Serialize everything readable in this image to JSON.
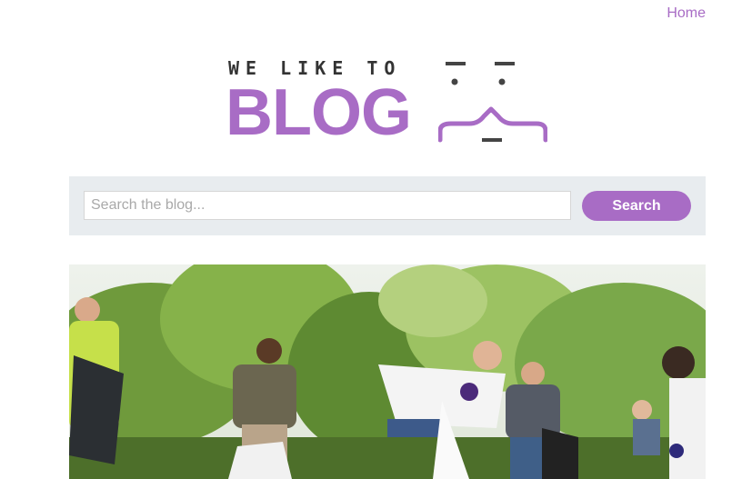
{
  "nav": {
    "home_label": "Home"
  },
  "logo": {
    "tagline": "WE LIKE TO",
    "wordmark": "BLOG"
  },
  "search": {
    "placeholder": "Search the blog...",
    "value": "",
    "button_label": "Search"
  },
  "colors": {
    "accent": "#a86cc5",
    "search_bar_bg": "#e8ecef",
    "face": "#444444"
  }
}
